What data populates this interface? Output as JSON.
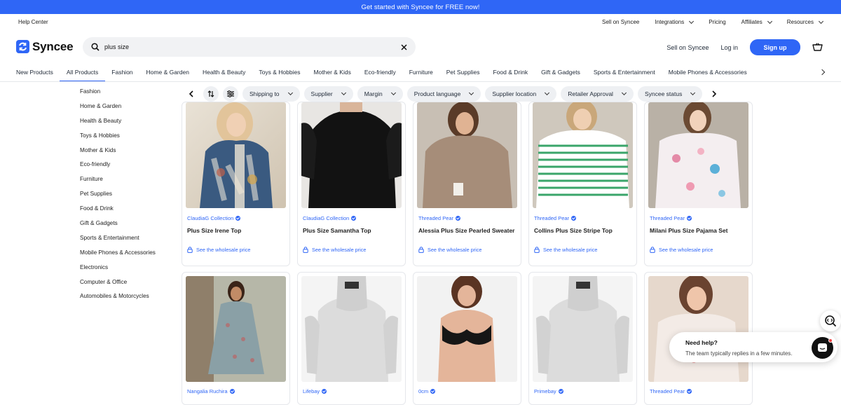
{
  "banner": {
    "text": "Get started with Syncee for FREE now!"
  },
  "util": {
    "help": "Help Center",
    "links": [
      "Sell on Syncee",
      "Integrations",
      "Pricing",
      "Affiliates",
      "Resources"
    ]
  },
  "header": {
    "logo": "Syncee",
    "search_value": "plus size",
    "sell": "Sell on Syncee",
    "login": "Log in",
    "signup": "Sign up"
  },
  "nav": [
    "New Products",
    "All Products",
    "Fashion",
    "Home & Garden",
    "Health & Beauty",
    "Toys & Hobbies",
    "Mother & Kids",
    "Eco-friendly",
    "Furniture",
    "Pet Supplies",
    "Food & Drink",
    "Gift & Gadgets",
    "Sports & Entertainment",
    "Mobile Phones & Accessories"
  ],
  "sidebar": [
    "Fashion",
    "Home & Garden",
    "Health & Beauty",
    "Toys & Hobbies",
    "Mother & Kids",
    "Eco-friendly",
    "Furniture",
    "Pet Supplies",
    "Food & Drink",
    "Gift & Gadgets",
    "Sports & Entertainment",
    "Mobile Phones & Accessories",
    "Electronics",
    "Computer & Office",
    "Automobiles & Motorcycles"
  ],
  "filters": [
    "Shipping to",
    "Supplier",
    "Margin",
    "Product language",
    "Supplier location",
    "Retailer Approval",
    "Syncee status"
  ],
  "products_row1": [
    {
      "supplier": "ClaudiaG Collection",
      "title": "Plus Size Irene Top",
      "price": "See the wholesale price"
    },
    {
      "supplier": "ClaudiaG Collection",
      "title": "Plus Size Samantha Top",
      "price": "See the wholesale price"
    },
    {
      "supplier": "Threaded Pear",
      "title": "Alessia Plus Size Pearled Sweater",
      "price": "See the wholesale price"
    },
    {
      "supplier": "Threaded Pear",
      "title": "Collins Plus Size Stripe Top",
      "price": "See the wholesale price"
    },
    {
      "supplier": "Threaded Pear",
      "title": "Milani Plus Size Pajama Set",
      "price": "See the wholesale price"
    }
  ],
  "products_row2": [
    {
      "supplier": "Nangalia Ruchira"
    },
    {
      "supplier": "Lifebay"
    },
    {
      "supplier": "0cm"
    },
    {
      "supplier": "Primebay"
    },
    {
      "supplier": "Threaded Pear"
    }
  ],
  "help": {
    "title": "Need help?",
    "subtitle": "The team typically replies in a few minutes."
  },
  "colors": {
    "accent": "#2f66f6"
  }
}
